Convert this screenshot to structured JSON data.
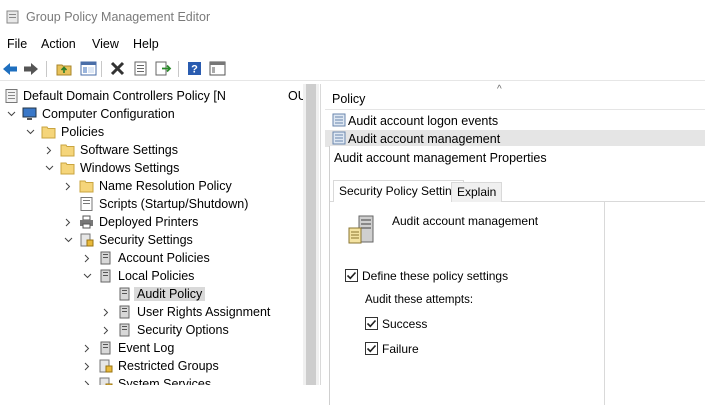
{
  "window": {
    "title": "Group Policy Management Editor"
  },
  "menu": [
    "File",
    "Action",
    "View",
    "Help"
  ],
  "toolbar": {
    "icons": [
      "back-arrow-icon",
      "forward-arrow-icon",
      "up-folder-icon",
      "show-hide-tree-icon",
      "delete-icon",
      "properties-icon",
      "export-icon",
      "help-icon",
      "view-icon"
    ]
  },
  "tree": {
    "root_label": "Default Domain Controllers Policy [N",
    "root_suffix": "OU",
    "items": [
      {
        "label": "Computer Configuration"
      },
      {
        "label": "Policies"
      },
      {
        "label": "Software Settings"
      },
      {
        "label": "Windows Settings"
      },
      {
        "label": "Name Resolution Policy"
      },
      {
        "label": "Scripts (Startup/Shutdown)"
      },
      {
        "label": "Deployed Printers"
      },
      {
        "label": "Security Settings"
      },
      {
        "label": "Account Policies"
      },
      {
        "label": "Local Policies"
      },
      {
        "label": "Audit Policy"
      },
      {
        "label": "User Rights Assignment"
      },
      {
        "label": "Security Options"
      },
      {
        "label": "Event Log"
      },
      {
        "label": "Restricted Groups"
      },
      {
        "label": "System Services"
      }
    ]
  },
  "list": {
    "column_header": "Policy",
    "rows": [
      {
        "label": "Audit account logon events"
      },
      {
        "label": "Audit account management"
      }
    ]
  },
  "dialog": {
    "title": "Audit account management Properties",
    "tabs": [
      "Security Policy Setting",
      "Explain"
    ],
    "policy_name": "Audit account management",
    "define_label": "Define these policy settings",
    "define_checked": true,
    "audit_label": "Audit these attempts:",
    "success_label": "Success",
    "success_checked": true,
    "failure_label": "Failure",
    "failure_checked": true
  }
}
